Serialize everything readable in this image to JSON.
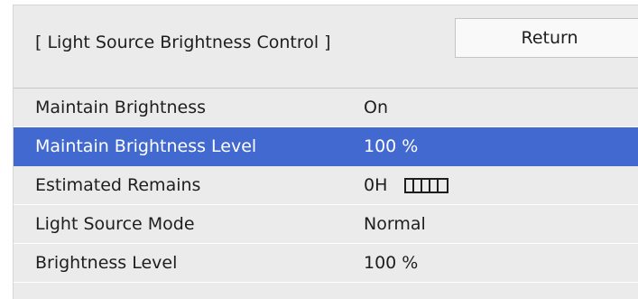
{
  "header": {
    "title": "[ Light Source Brightness Control ]",
    "return_label": "Return"
  },
  "menu": {
    "selected_index": 1,
    "items": [
      {
        "label": "Maintain Brightness",
        "value": "On"
      },
      {
        "label": "Maintain Brightness Level",
        "value": "100 %"
      },
      {
        "label": "Estimated Remains",
        "value": "0H",
        "gauge": {
          "segments": 5,
          "icon": "remaining-gauge-icon"
        }
      },
      {
        "label": "Light Source Mode",
        "value": "Normal"
      },
      {
        "label": "Brightness Level",
        "value": "100 %"
      }
    ]
  },
  "colors": {
    "panel_bg": "#ebebeb",
    "selected_bg": "#4169d0",
    "selected_text": "#ffffff",
    "text": "#1e1e1e"
  }
}
